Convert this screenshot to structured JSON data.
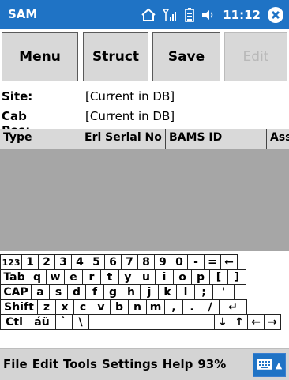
{
  "titlebar": {
    "app_name": "SAM",
    "time": "11:12"
  },
  "toolbar": {
    "menu": "Menu",
    "struct": "Struct",
    "save": "Save",
    "edit": "Edit"
  },
  "fields": {
    "site_label": "Site:",
    "site_value": "[Current in DB]",
    "cab_label": "Cab Pos:",
    "cab_value": "[Current in DB]"
  },
  "grid": {
    "columns": [
      "Type",
      "Eri Serial No",
      "BAMS ID",
      "Ass"
    ]
  },
  "keyboard": {
    "rows": [
      [
        "123",
        "1",
        "2",
        "3",
        "4",
        "5",
        "6",
        "7",
        "8",
        "9",
        "0",
        "-",
        "=",
        "←"
      ],
      [
        "Tab",
        "q",
        "w",
        "e",
        "r",
        "t",
        "y",
        "u",
        "i",
        "o",
        "p",
        "[",
        "]"
      ],
      [
        "CAP",
        "a",
        "s",
        "d",
        "f",
        "g",
        "h",
        "j",
        "k",
        "l",
        ";",
        "'"
      ],
      [
        "Shift",
        "z",
        "x",
        "c",
        "v",
        "b",
        "n",
        "m",
        ",",
        ".",
        "/",
        "↵"
      ],
      [
        "Ctl",
        "áü",
        "`",
        "\\",
        "",
        "↓",
        "↑",
        "←",
        "→"
      ]
    ]
  },
  "menubar": {
    "items": [
      "File",
      "Edit",
      "Tools",
      "Settings",
      "Help",
      "93%"
    ]
  }
}
